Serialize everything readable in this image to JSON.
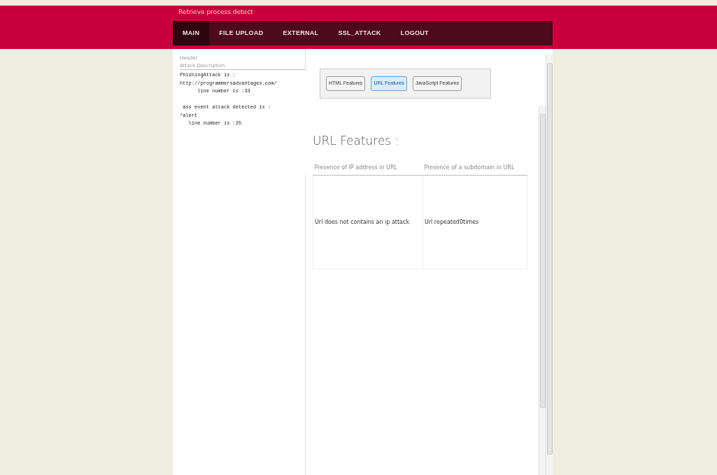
{
  "header": {
    "title": "Retrieve process detect"
  },
  "nav": [
    {
      "label": "MAIN",
      "selected": true
    },
    {
      "label": "FILE UPLOAD",
      "selected": false
    },
    {
      "label": "EXTERNAL",
      "selected": false
    },
    {
      "label": "SSL_ATTACK",
      "selected": false
    },
    {
      "label": "LOGOUT",
      "selected": false
    }
  ],
  "left_panel": {
    "header_label": "Header",
    "description_label": "Attack Description",
    "attack_text": "PhishingAttack is :\nhttp://programmersadvantages.com/\n      line number is :33\n\n ass event attack detected is :\n*alert\n   line number is :25"
  },
  "feature_tabs": [
    {
      "label": "HTML Features",
      "selected": false
    },
    {
      "label": "URL Features",
      "selected": true
    },
    {
      "label": "JavaScript Features",
      "selected": false
    }
  ],
  "section_title": "URL Features :",
  "table": {
    "columns": [
      "Presence of IP address in URL",
      "Presence of a subdomain in URL"
    ],
    "rows": [
      [
        "Url does not contains an ip attack",
        "Url repeated0times"
      ]
    ]
  }
}
